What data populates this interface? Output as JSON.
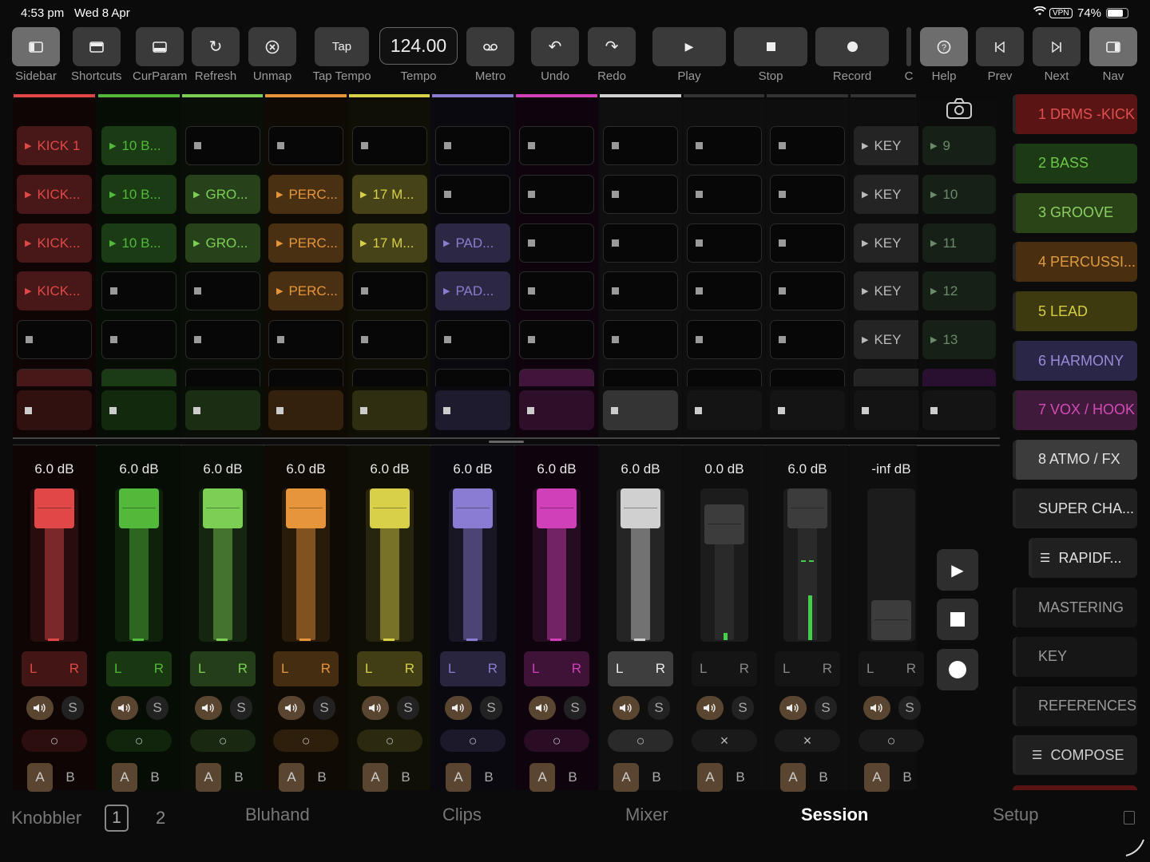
{
  "status": {
    "time": "4:53 pm",
    "date": "Wed 8 Apr",
    "vpn": "VPN",
    "battery": "74%"
  },
  "toolbar": {
    "sidebar": "Sidebar",
    "shortcuts": "Shortcuts",
    "curparam": "CurParam",
    "refresh": "Refresh",
    "unmap": "Unmap",
    "tap_btn": "Tap",
    "tap_tempo": "Tap Tempo",
    "tempo_value": "124.00",
    "tempo": "Tempo",
    "metro": "Metro",
    "undo": "Undo",
    "redo": "Redo",
    "play": "Play",
    "stop": "Stop",
    "record": "Record",
    "cut": "C",
    "help": "Help",
    "prev": "Prev",
    "next": "Next",
    "nav": "Nav"
  },
  "tracks": [
    {
      "name": "1 DRMS -...",
      "color": "#e04848",
      "clips": [
        "KICK 1",
        "KICK...",
        "KICK...",
        "KICK...",
        ""
      ]
    },
    {
      "name": "2 BASS",
      "color": "#52b93a",
      "clips": [
        "10 B...",
        "10 B...",
        "10 B...",
        "",
        ""
      ]
    },
    {
      "name": "3 GROOVE",
      "color": "#7bcf55",
      "clips": [
        "",
        "GRO...",
        "GRO...",
        "",
        ""
      ]
    },
    {
      "name": "4 PERCU...",
      "color": "#e6953a",
      "clips": [
        "",
        "PERC...",
        "PERC...",
        "PERC...",
        ""
      ]
    },
    {
      "name": "5 LEAD",
      "color": "#d8d048",
      "clips": [
        "",
        "17 M...",
        "17 M...",
        "",
        ""
      ]
    },
    {
      "name": "6 HARM...",
      "color": "#8a7cd0",
      "clips": [
        "",
        "",
        "PAD...",
        "PAD...",
        ""
      ]
    },
    {
      "name": "7 VOX /...",
      "color": "#d040b8",
      "clips": [
        "",
        "",
        "",
        "",
        ""
      ]
    },
    {
      "name": "8 ATMO /...",
      "color": "#d0d0d0",
      "clips": [
        "",
        "",
        "",
        "",
        ""
      ]
    },
    {
      "name": "SUPER...",
      "color": "#505050",
      "clips": [
        "",
        "",
        "",
        "",
        ""
      ]
    },
    {
      "name": "MASTERI...",
      "color": "#505050",
      "clips": [
        "",
        "",
        "",
        "",
        ""
      ]
    },
    {
      "name": "KEY",
      "color": "#505050",
      "clips": [
        "KEY",
        "KEY",
        "KEY",
        "KEY",
        "KEY"
      ]
    }
  ],
  "scenes": [
    "9",
    "10",
    "11",
    "12",
    "13"
  ],
  "mixer": [
    {
      "db": "6.0 dB",
      "level": 1.0,
      "arm": "○"
    },
    {
      "db": "6.0 dB",
      "level": 1.0,
      "arm": "○"
    },
    {
      "db": "6.0 dB",
      "level": 1.0,
      "arm": "○"
    },
    {
      "db": "6.0 dB",
      "level": 1.0,
      "arm": "○"
    },
    {
      "db": "6.0 dB",
      "level": 1.0,
      "arm": "○"
    },
    {
      "db": "6.0 dB",
      "level": 1.0,
      "arm": "○"
    },
    {
      "db": "6.0 dB",
      "level": 1.0,
      "arm": "○"
    },
    {
      "db": "6.0 dB",
      "level": 1.0,
      "arm": "○"
    },
    {
      "db": "0.0 dB",
      "level": 0.85,
      "arm": "×"
    },
    {
      "db": "6.0 dB",
      "level": 1.0,
      "arm": "×"
    },
    {
      "db": "-inf dB",
      "level": 0.0,
      "arm": "○"
    }
  ],
  "mixer_labels": {
    "l": "L",
    "r": "R",
    "s": "S",
    "a": "A",
    "b": "B"
  },
  "sidebar_tracks": [
    {
      "label": "1 DRMS -KICK",
      "bg": "#5a1414",
      "fg": "#e05050"
    },
    {
      "label": "2 BASS",
      "bg": "#1c3a14",
      "fg": "#6cc64a"
    },
    {
      "label": "3 GROOVE",
      "bg": "#2a4418",
      "fg": "#8ad060"
    },
    {
      "label": "4 PERCUSSI...",
      "bg": "#4a2e10",
      "fg": "#e09a40"
    },
    {
      "label": "5 LEAD",
      "bg": "#3e3a10",
      "fg": "#d6cc44"
    },
    {
      "label": "6 HARMONY",
      "bg": "#2a2648",
      "fg": "#9a8ad8"
    },
    {
      "label": "7 VOX / HOOK",
      "bg": "#401a3a",
      "fg": "#d24cb8"
    },
    {
      "label": "8 ATMO / FX",
      "bg": "#3c3c3c",
      "fg": "#e0e0e0"
    },
    {
      "label": "SUPER CHA...",
      "bg": "#202020",
      "fg": "#e0e0e0"
    },
    {
      "label": "RAPIDF...",
      "bg": "#202020",
      "fg": "#e0e0e0"
    },
    {
      "label": "MASTERING",
      "bg": "#161616",
      "fg": "#9a9a9a"
    },
    {
      "label": "KEY",
      "bg": "#161616",
      "fg": "#9a9a9a"
    },
    {
      "label": "REFERENCES",
      "bg": "#161616",
      "fg": "#9a9a9a"
    },
    {
      "label": "COMPOSE",
      "bg": "#202020",
      "fg": "#cfcfcf"
    }
  ],
  "tabs": {
    "knobbler": "Knobbler",
    "page1": "1",
    "page2": "2",
    "bluhand": "Bluhand",
    "clips": "Clips",
    "mixer": "Mixer",
    "session": "Session",
    "setup": "Setup"
  }
}
